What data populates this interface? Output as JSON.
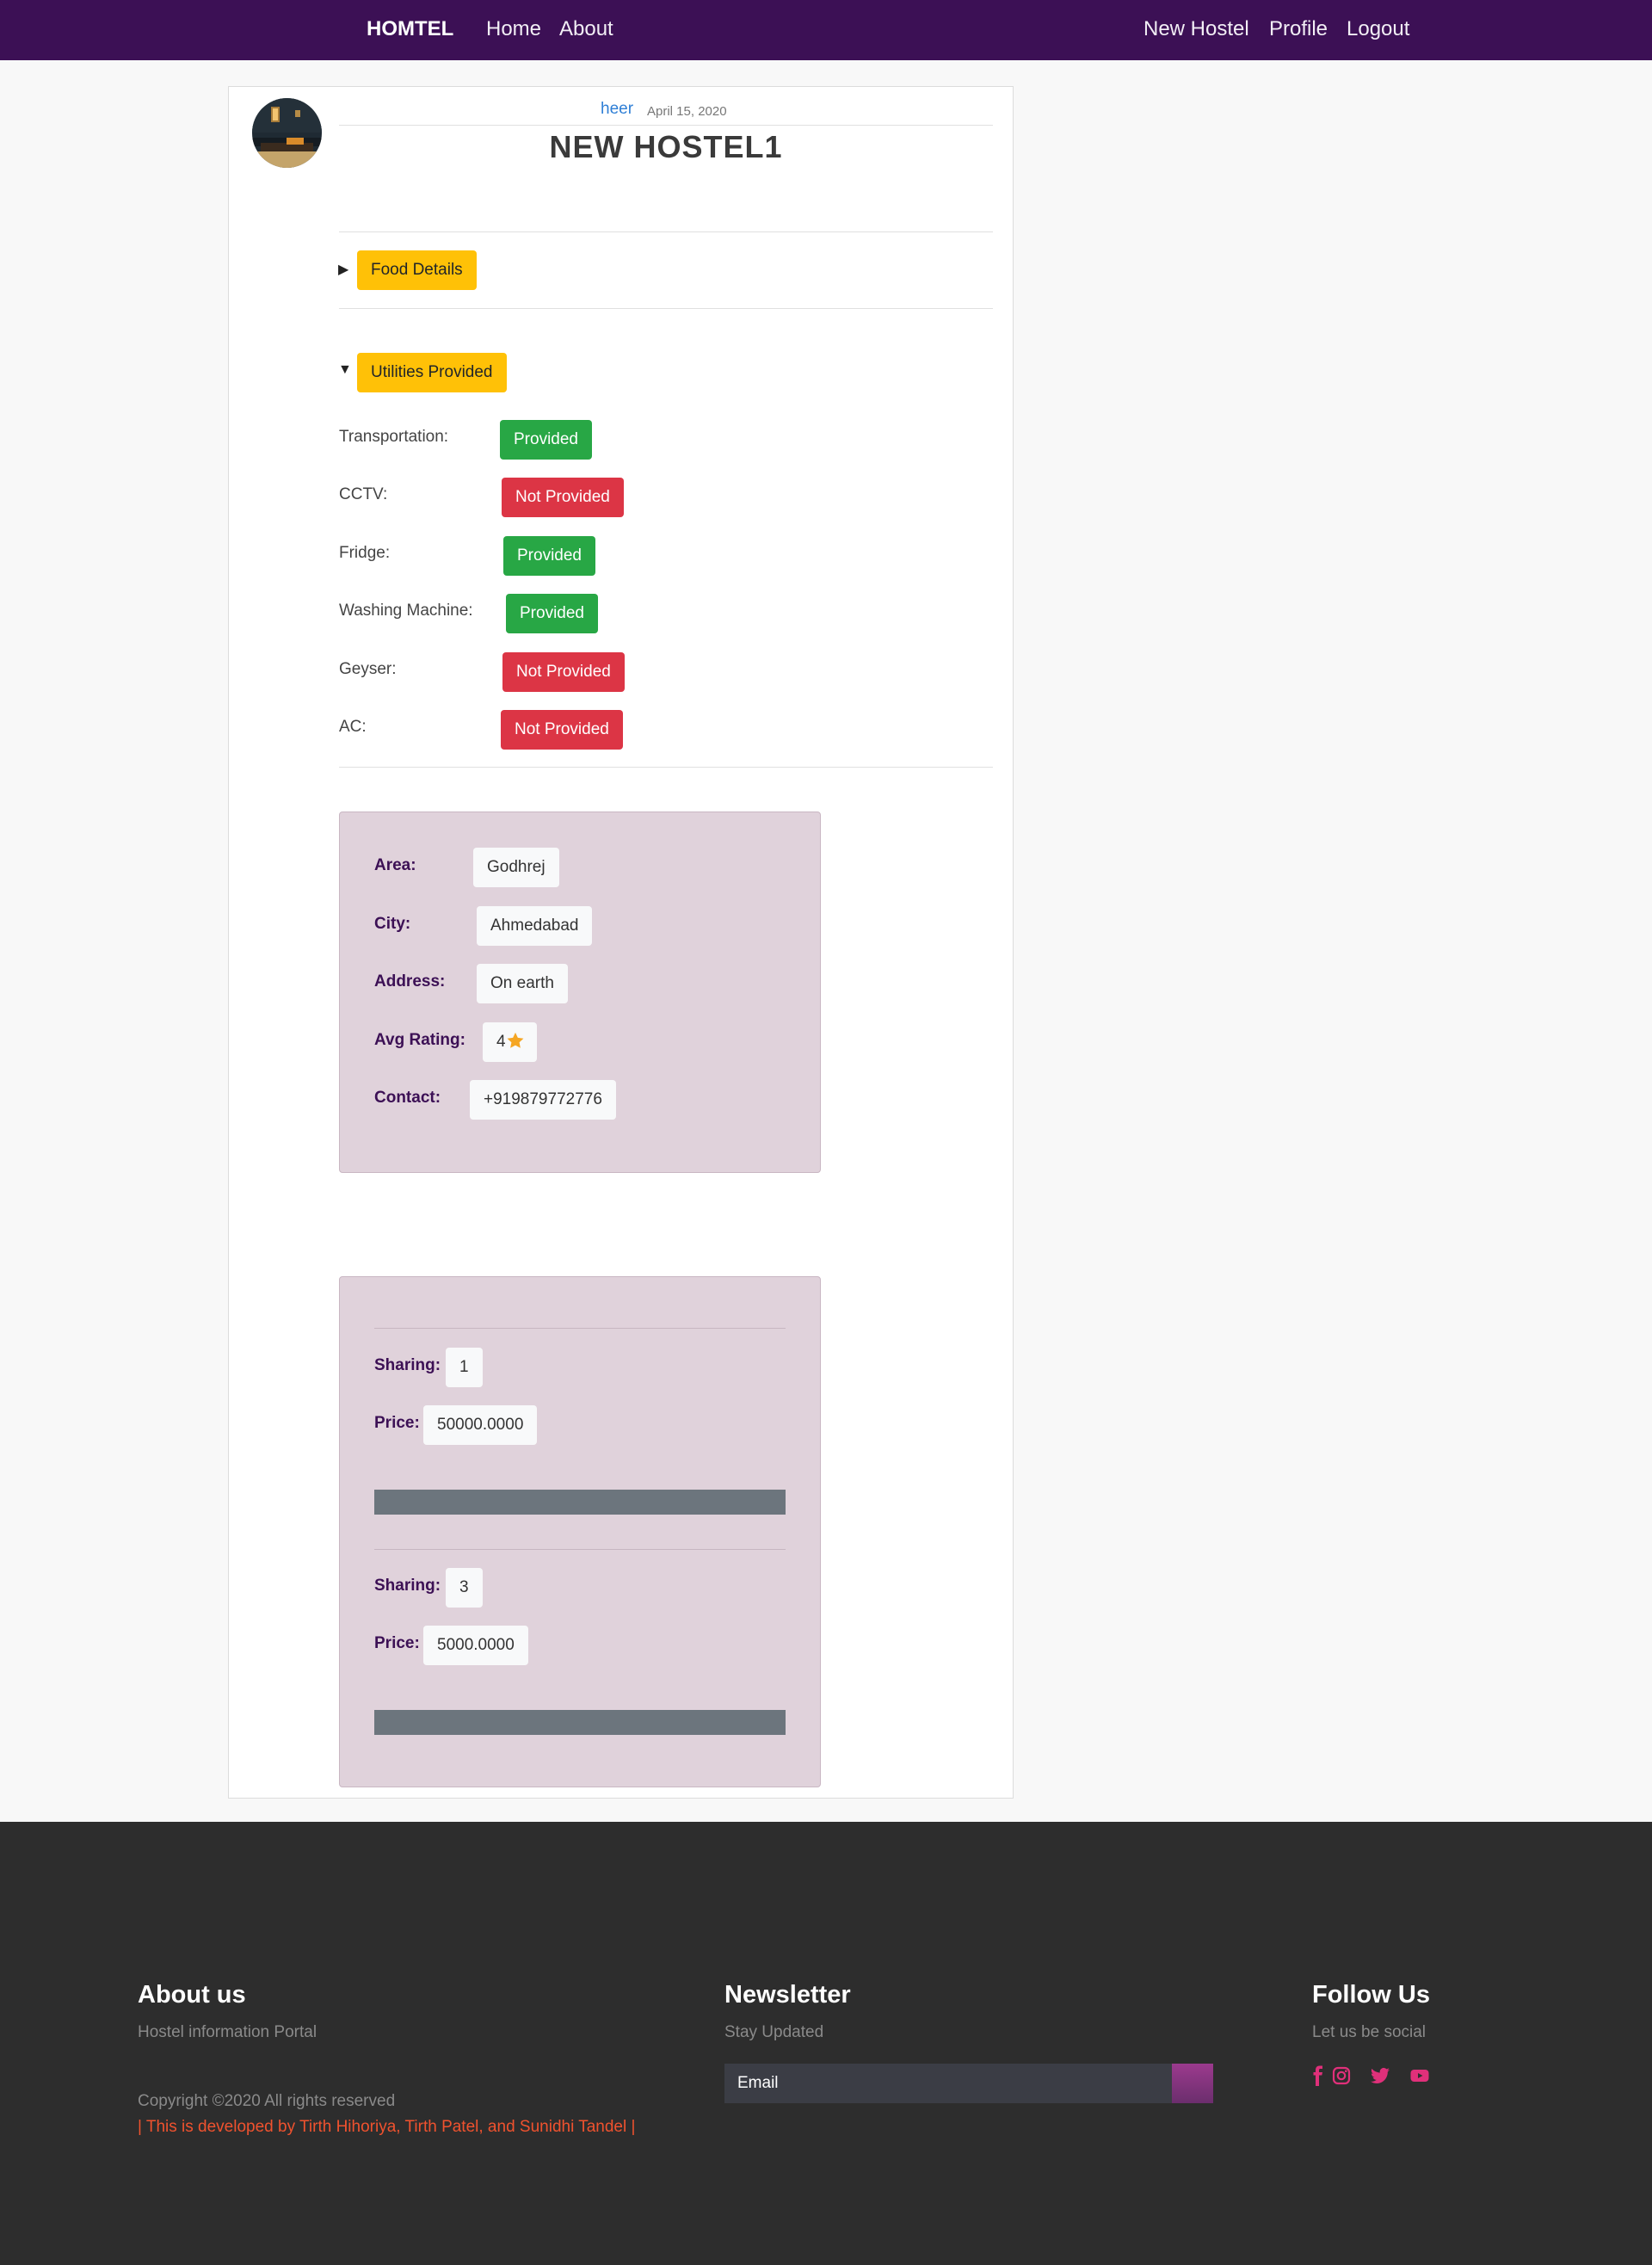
{
  "nav": {
    "brand": "HOMTEL",
    "home": "Home",
    "about": "About",
    "new_hostel": "New Hostel",
    "profile": "Profile",
    "logout": "Logout"
  },
  "post": {
    "author": "heer",
    "date": "April 15, 2020",
    "title": "NEW HOSTEL1"
  },
  "sections": {
    "food": "Food Details",
    "utilities": "Utilities Provided"
  },
  "utilities": [
    {
      "label": "Transportation:",
      "status": "Provided"
    },
    {
      "label": "CCTV:",
      "status": "Not Provided"
    },
    {
      "label": "Fridge:",
      "status": "Provided"
    },
    {
      "label": "Washing Machine:",
      "status": "Provided"
    },
    {
      "label": "Geyser:",
      "status": "Not Provided"
    },
    {
      "label": "AC:",
      "status": "Not Provided"
    }
  ],
  "details": {
    "area_label": "Area:",
    "area": "Godhrej",
    "city_label": "City:",
    "city": "Ahmedabad",
    "address_label": "Address:",
    "address": "On earth",
    "rating_label": "Avg Rating:",
    "rating": "4",
    "contact_label": "Contact:",
    "contact": "+919879772776"
  },
  "rooms": [
    {
      "sharing_label": "Sharing:",
      "sharing": "1",
      "price_label": "Price:",
      "price": "50000.0000"
    },
    {
      "sharing_label": "Sharing:",
      "sharing": "3",
      "price_label": "Price:",
      "price": "5000.0000"
    }
  ],
  "footer": {
    "about_title": "About us",
    "about_text": "Hostel information Portal",
    "copyright": "Copyright ©2020 All rights reserved",
    "credits": "| This is developed by Tirth Hihoriya, Tirth Patel, and Sunidhi Tandel |",
    "newsletter_title": "Newsletter",
    "newsletter_text": "Stay Updated",
    "email_placeholder": "Email",
    "follow_title": "Follow Us",
    "follow_text": "Let us be social"
  },
  "colors": {
    "navbar": "#3c1055",
    "provided": "#28a745",
    "not_provided": "#dc3545",
    "summary": "#ffc107",
    "info_box": "#e0d2db",
    "footer": "#2d2d2d",
    "social": "#e0307a",
    "star": "#f5a623"
  },
  "icons": {
    "rating": "star-icon",
    "social": [
      "facebook-icon",
      "instagram-icon",
      "twitter-icon",
      "youtube-icon"
    ]
  }
}
